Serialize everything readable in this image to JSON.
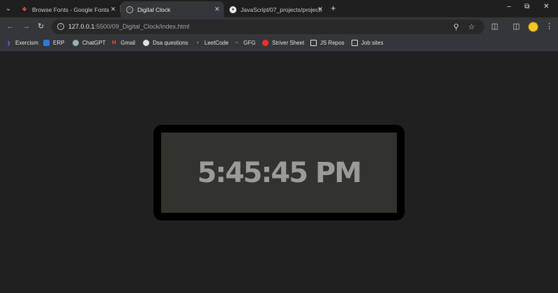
{
  "browser": {
    "tabs": [
      {
        "title": "Browse Fonts - Google Fonts",
        "icon": "google-fonts-icon",
        "active": false
      },
      {
        "title": "Digital Clock",
        "icon": "globe-icon",
        "active": true
      },
      {
        "title": "JavaScript/07_projects/projects",
        "icon": "github-icon",
        "active": false
      }
    ],
    "new_tab_label": "+",
    "address": {
      "host": "127.0.0.1",
      "path": ":5500/09_Digital_Clock/index.html"
    },
    "bookmarks": [
      {
        "label": "Exercism",
        "icon": "exercism-icon",
        "color": "#6e5ef2"
      },
      {
        "label": "ERP",
        "icon": "erp-icon",
        "color": "#2f7ad8"
      },
      {
        "label": "ChatGPT",
        "icon": "chatgpt-icon",
        "color": "#8fb8a8"
      },
      {
        "label": "Gmail",
        "icon": "gmail-icon",
        "color": "#e64a3b"
      },
      {
        "label": "Dsa questions",
        "icon": "github-icon",
        "color": "#e0e0e0"
      },
      {
        "label": "LeetCode",
        "icon": "leetcode-icon",
        "color": "#f5a623"
      },
      {
        "label": "GFG",
        "icon": "gfg-icon",
        "color": "#2f8d46"
      },
      {
        "label": "Striver Sheet",
        "icon": "striver-icon",
        "color": "#e8322f"
      },
      {
        "label": "JS Repos",
        "icon": "folder-icon",
        "color": "#e0e0e0"
      },
      {
        "label": "Job sites",
        "icon": "folder-icon",
        "color": "#e0e0e0"
      }
    ]
  },
  "page": {
    "clock": {
      "time": "5:45:45 PM"
    }
  }
}
